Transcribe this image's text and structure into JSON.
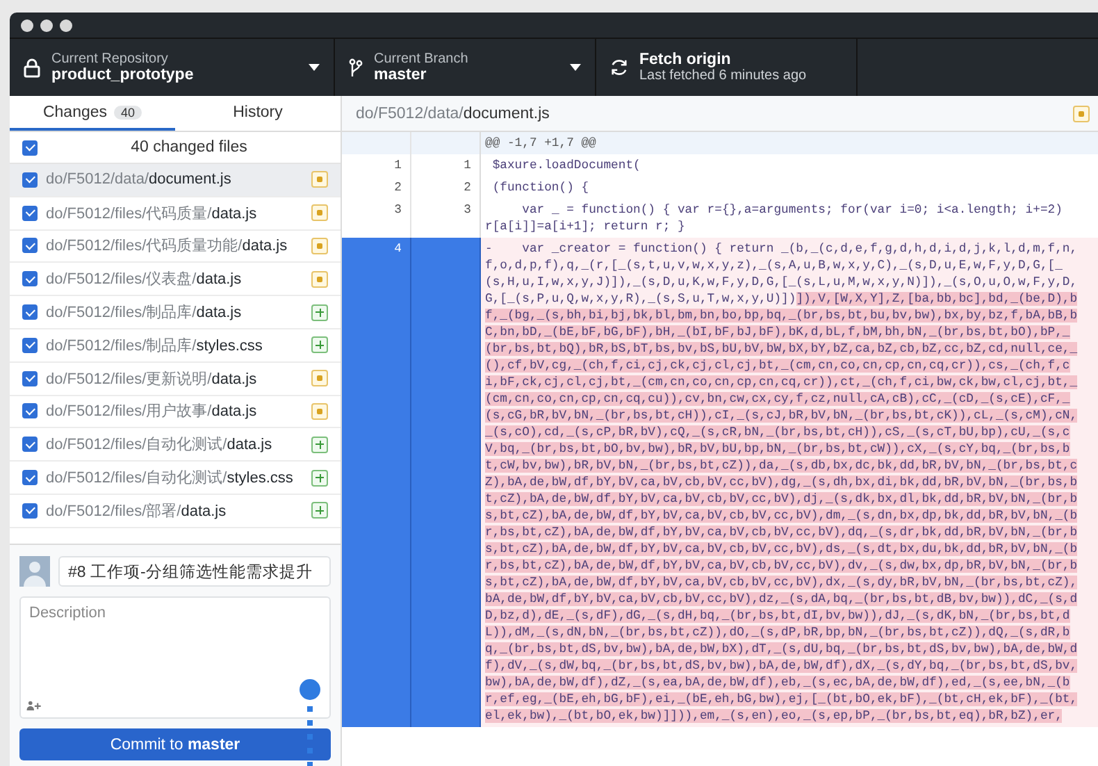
{
  "toolbar": {
    "repository": {
      "label": "Current Repository",
      "value": "product_prototype"
    },
    "branch": {
      "label": "Current Branch",
      "value": "master"
    },
    "fetch": {
      "label": "Fetch origin",
      "detail": "Last fetched 6 minutes ago"
    }
  },
  "tabs": [
    {
      "label": "Changes",
      "count": "40",
      "selected": true
    },
    {
      "label": "History",
      "selected": false
    }
  ],
  "changes": {
    "summary": "40 changed files",
    "checked": true,
    "files": [
      {
        "dir": "do/F5012/data/",
        "name": "document.js",
        "kind": "modified",
        "checked": true,
        "selected": true
      },
      {
        "dir": "do/F5012/files/代码质量/",
        "name": "data.js",
        "kind": "modified",
        "checked": true,
        "selected": false
      },
      {
        "dir": "do/F5012/files/代码质量功能/",
        "name": "data.js",
        "kind": "modified",
        "checked": true,
        "selected": false
      },
      {
        "dir": "do/F5012/files/仪表盘/",
        "name": "data.js",
        "kind": "modified",
        "checked": true,
        "selected": false
      },
      {
        "dir": "do/F5012/files/制品库/",
        "name": "data.js",
        "kind": "added",
        "checked": true,
        "selected": false
      },
      {
        "dir": "do/F5012/files/制品库/",
        "name": "styles.css",
        "kind": "added",
        "checked": true,
        "selected": false
      },
      {
        "dir": "do/F5012/files/更新说明/",
        "name": "data.js",
        "kind": "modified",
        "checked": true,
        "selected": false
      },
      {
        "dir": "do/F5012/files/用户故事/",
        "name": "data.js",
        "kind": "modified",
        "checked": true,
        "selected": false
      },
      {
        "dir": "do/F5012/files/自动化测试/",
        "name": "data.js",
        "kind": "added",
        "checked": true,
        "selected": false
      },
      {
        "dir": "do/F5012/files/自动化测试/",
        "name": "styles.css",
        "kind": "added",
        "checked": true,
        "selected": false
      },
      {
        "dir": "do/F5012/files/部署/",
        "name": "data.js",
        "kind": "added",
        "checked": true,
        "selected": false
      }
    ]
  },
  "commit": {
    "summary": "#8 工作项-分组筛选性能需求提升",
    "description_placeholder": "Description",
    "button": "Commit to **master**"
  },
  "diff": {
    "file": {
      "dir": "do/F5012/data/",
      "name": "document.js",
      "kind": "modified"
    },
    "lines": [
      {
        "kind": "hunk",
        "selected": false,
        "segments": [
          {
            "text": "@@ -1,7 +1,7 @@",
            "changed": false
          }
        ]
      },
      {
        "kind": "context",
        "old": "1",
        "new": "1",
        "selected": false,
        "segments": [
          {
            "text": " $axure.loadDocument(",
            "changed": false
          }
        ]
      },
      {
        "kind": "context",
        "old": "2",
        "new": "2",
        "selected": false,
        "segments": [
          {
            "text": " (function() {",
            "changed": false
          }
        ]
      },
      {
        "kind": "context",
        "old": "3",
        "new": "3",
        "selected": false,
        "segments": [
          {
            "text": "     var _ = function() { var r={},a=arguments; for(var i=0; i<a.length; i+=2) r[a[i]]=a[i+1]; return r; }",
            "changed": false
          }
        ]
      },
      {
        "kind": "deleted",
        "old": "4",
        "selected": true,
        "segments": [
          {
            "text": "-    var _creator = function() { return _(b,_(c,d,e,f,g,d,h,d,i,d,j,k,l,d,m,f,n,f,o,d,p,f),q,_(r,[_(s,t,u,v,w,x,y,z),_(s,A,u,B,w,x,y,C),_(s,D,u,E,w,F,y,D,G,[_(s,H,u,I,w,x,y,J)]),_(s,D,u,K,w,F,y,D,G,[_(s,L,u,M,w,x,y,N)]),_(s,O,u,O,w,F,y,D,G,[_(s,P,u,Q,w,x,y,R),_(s,S,u,T,w,x,y,U)])",
            "changed": false
          },
          {
            "text": "]),V,[W,X,Y],Z,[ba,bb,bc],bd,_(be,D),bf,_(bg,_(s,bh,bi,bj,bk,bl,bm,bn,bo,bp,bq,_(br,bs,bt,bu,bv,bw),bx,by,bz,f,bA,bB,bC,bn,bD,_(bE,bF,bG,bF),bH,_(bI,bF,bJ,bF),bK,d,bL,f,bM,bh,bN,_(br,bs,bt,bO),bP,_(br,bs,bt,bQ),bR,bS,bT,bs,bv,bS,bU,bV,bW,bX,bY,bZ,ca,bZ,cb,bZ,cc,bZ,cd,null,ce,_(),cf,bV,cg,_(ch,f,ci,cj,ck,cj,cl,cj,bt,_(cm,cn,co,cn,cp,cn,cq,cr)),cs,_(ch,f,ci,bF,ck,cj,cl,cj,bt,_(cm,cn,co,cn,cp,cn,cq,cr)),ct,_(ch,f,ci,bw,ck,bw,cl,cj,bt,_(cm,cn,co,cn,cp,cn,cq,cu)),cv,bn,cw,cx,cy,f,cz,null,cA,cB),cC,_(cD,_(s,cE),cF,_(s,cG,bR,bV,bN,_(br,bs,bt,cH)),cI,_(s,cJ,bR,bV,bN,_(br,bs,bt,cK)),cL,_(s,cM),cN,_(s,cO),cd,_(s,cP,bR,bV),cQ,_(s,cR,bN,_(br,bs,bt,cH)),cS,_(s,cT,bU,bp),cU,_(s,cV,bq,_(br,bs,bt,bO,bv,bw),bR,bV,bU,bp,bN,_(br,bs,bt,cW)),cX,_(s,cY,bq,_(br,bs,bt,cW,bv,bw),bR,bV,bN,_(br,bs,bt,cZ)),da,_(s,db,bx,dc,bk,dd,bR,bV,bN,_(br,bs,bt,cZ),bA,de,bW,df,bY,bV,ca,bV,cb,bV,cc,bV),dg,_(s,dh,bx,di,bk,dd,bR,bV,bN,_(br,bs,bt,cZ),bA,de,bW,df,bY,bV,ca,bV,cb,bV,cc,bV),dj,_(s,dk,bx,dl,bk,dd,bR,bV,bN,_(br,bs,bt,cZ),bA,de,bW,df,bY,bV,ca,bV,cb,bV,cc,bV),dm,_(s,dn,bx,dp,bk,dd,bR,bV,bN,_(br,bs,bt,cZ),bA,de,bW,df,bY,bV,ca,bV,cb,bV,cc,bV),dq,_(s,dr,bk,dd,bR,bV,bN,_(br,bs,bt,cZ),bA,de,bW,df,bY,bV,ca,bV,cb,bV,cc,bV),ds,_(s,dt,bx,du,bk,dd,bR,bV,bN,_(br,bs,bt,cZ),bA,de,bW,df,bY,bV,ca,bV,cb,bV,cc,bV),dv,_(s,dw,bx,dp,bR,bV,bN,_(br,bs,bt,cZ),bA,de,bW,df,bY,bV,ca,bV,cb,bV,cc,bV),dx,_(s,dy,bR,bV,bN,_(br,bs,bt,cZ),bA,de,bW,df,bY,bV,ca,bV,cb,bV,cc,bV),dz,_(s,dA,bq,_(br,bs,bt,dB,bv,bw)),dC,_(s,dD,bz,d),dE,_(s,dF),dG,_(s,dH,bq,_(br,bs,bt,dI,bv,bw)),dJ,_(s,dK,bN,_(br,bs,bt,dL)),dM,_(s,dN,bN,_(br,bs,bt,cZ)),dO,_(s,dP,bR,bp,bN,_(br,bs,bt,cZ)),dQ,_(s,dR,bq,_(br,bs,bt,dS,bv,bw),bA,de,bW,bX),dT,_(s,dU,bq,_(br,bs,bt,dS,bv,bw),bA,de,bW,df),dV,_(s,dW,bq,_(br,bs,bt,dS,bv,bw),bA,de,bW,df),dX,_(s,dY,bq,_(br,bs,bt,dS,bv,bw),bA,de,bW,df),dZ,_(s,ea,bA,de,bW,df),eb,_(s,ec,bA,de,bW,df),ed,_(s,ee,bN,_(br,ef,eg,_(bE,eh,bG,bF),ei,_(bE,eh,bG,bw),ej,[_(bt,bO,ek,bF),_(bt,cH,ek,bF),_(bt,el,ek,bw),_(bt,bO,ek,bw)]])),em,_(s,en),eo,_(s,ep,bP,_(br,bs,bt,eq),bR,bZ),er,",
            "changed": true
          }
        ]
      }
    ]
  }
}
